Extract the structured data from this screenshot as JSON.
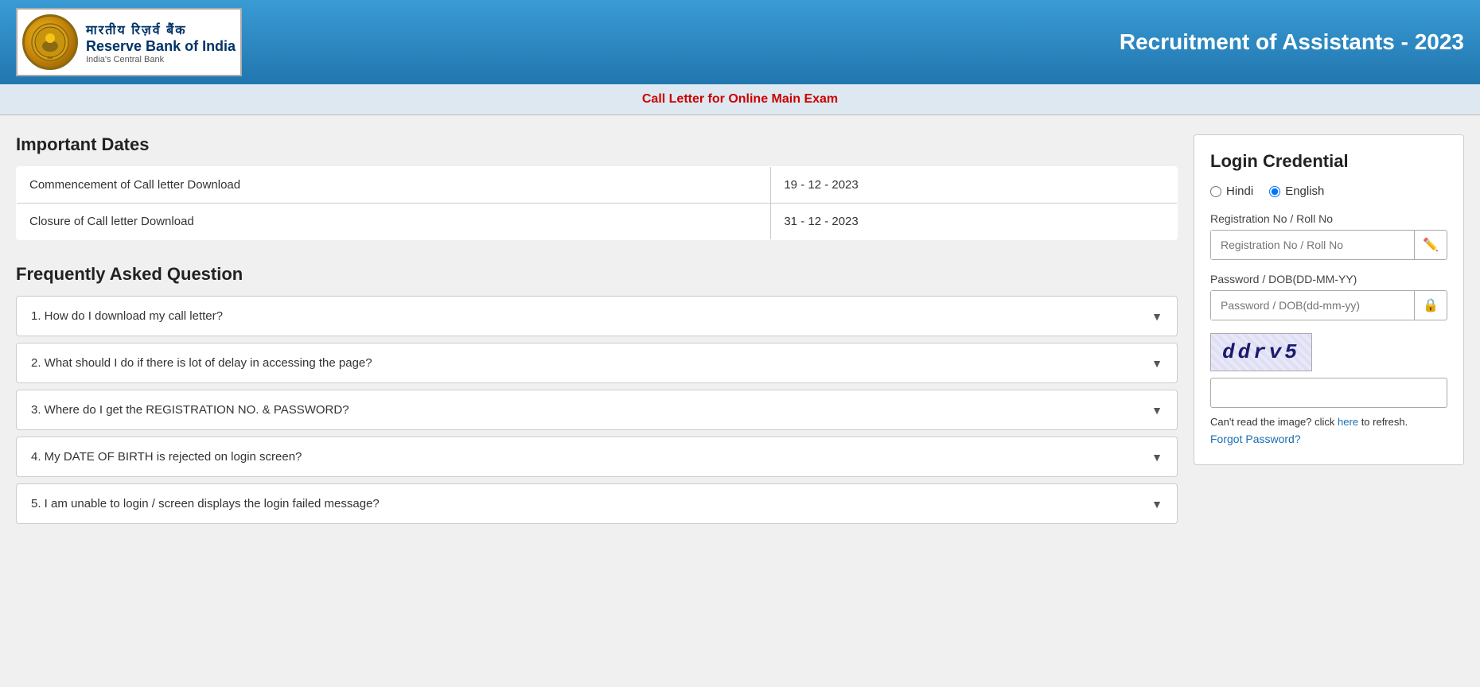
{
  "header": {
    "logo_hi": "मारतीय  रिज़र्व  बैंक",
    "logo_en": "Reserve Bank of India",
    "logo_sub": "India's Central Bank",
    "title": "Recruitment of Assistants - 2023"
  },
  "sub_header": {
    "text": "Call Letter for Online Main Exam"
  },
  "important_dates": {
    "section_title": "Important Dates",
    "rows": [
      {
        "label": "Commencement of Call letter Download",
        "value": "19 - 12 - 2023"
      },
      {
        "label": "Closure of Call letter Download",
        "value": "31 - 12 - 2023"
      }
    ]
  },
  "faq": {
    "section_title": "Frequently Asked Question",
    "items": [
      {
        "question": "1. How do I download my call letter?"
      },
      {
        "question": "2. What should I do if there is lot of delay in accessing the page?"
      },
      {
        "question": "3. Where do I get the REGISTRATION NO. & PASSWORD?"
      },
      {
        "question": "4. My DATE OF BIRTH is rejected on login screen?"
      },
      {
        "question": "5. I am unable to login / screen displays the login failed message?"
      }
    ]
  },
  "login": {
    "title": "Login Credential",
    "language_options": [
      "Hindi",
      "English"
    ],
    "selected_language": "English",
    "reg_label": "Registration No / Roll No",
    "reg_placeholder": "Registration No / Roll No",
    "password_label": "Password / DOB(DD-MM-YY)",
    "password_placeholder": "Password / DOB(dd-mm-yy)",
    "captcha_text": "ddrv5",
    "captcha_input_placeholder": "",
    "refresh_text": "Can't read the image? click",
    "refresh_link_text": "here",
    "refresh_suffix": "to refresh.",
    "forgot_password": "Forgot Password?"
  }
}
